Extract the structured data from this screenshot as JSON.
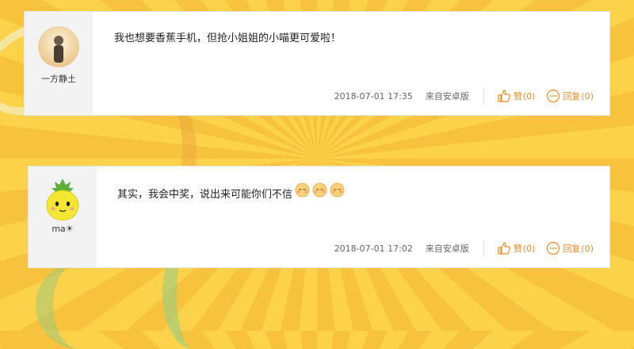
{
  "comments": [
    {
      "username": "一方静土",
      "text": "我也想要香蕉手机，但抢小姐姐的小喵更可爱啦！",
      "emojis": [],
      "time": "2018-07-01 17:35",
      "source": "来自安卓版",
      "like_label": "赞",
      "like_count": "(0)",
      "reply_label": "回复",
      "reply_count": "(0)"
    },
    {
      "username": "ma☀",
      "text": "其实，我会中奖，说出来可能你们不信",
      "emojis": [
        "sleepy-face-icon",
        "sleepy-face-icon",
        "sleepy-face-icon"
      ],
      "time": "2018-07-01 17:02",
      "source": "来自安卓版",
      "like_label": "赞",
      "like_count": "(0)",
      "reply_label": "回复",
      "reply_count": "(0)"
    }
  ],
  "colors": {
    "accent": "#f08a24",
    "background": "#fcd24a"
  }
}
